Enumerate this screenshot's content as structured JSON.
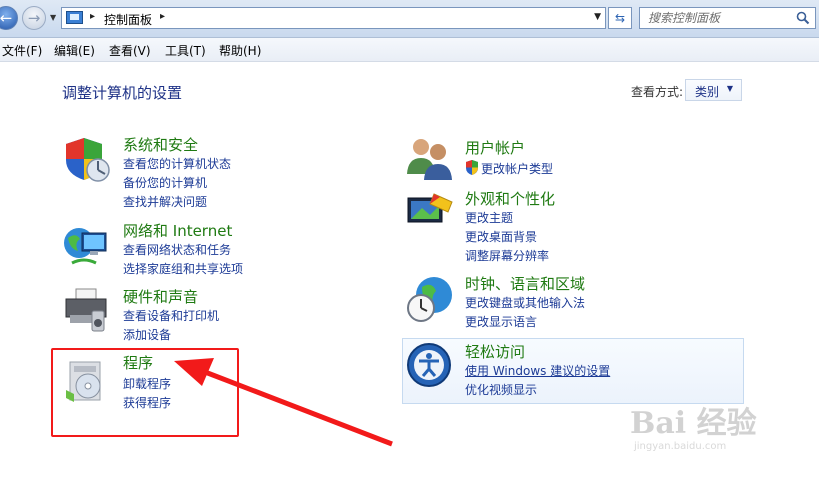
{
  "address_bar": {
    "back_glyph": "←",
    "forward_glyph": "→",
    "breadcrumb": "控制面板",
    "search_placeholder": "搜索控制面板",
    "refresh_glyph": "⇆"
  },
  "menu": [
    "文件(F)",
    "编辑(E)",
    "查看(V)",
    "工具(T)",
    "帮助(H)"
  ],
  "page_title": "调整计算机的设置",
  "view_by": {
    "label": "查看方式:",
    "value": "类别"
  },
  "categories_left": [
    {
      "title": "系统和安全",
      "links": [
        "查看您的计算机状态",
        "备份您的计算机",
        "查找并解决问题"
      ],
      "icon": "shield-icon"
    },
    {
      "title": "网络和 Internet",
      "links": [
        "查看网络状态和任务",
        "选择家庭组和共享选项"
      ],
      "icon": "network-globe-icon"
    },
    {
      "title": "硬件和声音",
      "links": [
        "查看设备和打印机",
        "添加设备"
      ],
      "icon": "printer-icon"
    },
    {
      "title": "程序",
      "links": [
        "卸载程序",
        "获得程序"
      ],
      "icon": "programs-disc-icon"
    }
  ],
  "categories_right": [
    {
      "title": "用户帐户",
      "links": [
        "更改帐户类型"
      ],
      "icon": "users-icon"
    },
    {
      "title": "外观和个性化",
      "links": [
        "更改主题",
        "更改桌面背景",
        "调整屏幕分辨率"
      ],
      "icon": "monitor-paint-icon"
    },
    {
      "title": "时钟、语言和区域",
      "links": [
        "更改键盘或其他输入法",
        "更改显示语言"
      ],
      "icon": "clock-globe-icon"
    },
    {
      "title": "轻松访问",
      "links": [
        "使用 Windows 建议的设置",
        "优化视频显示"
      ],
      "icon": "ease-of-access-icon"
    }
  ],
  "watermark": {
    "text": "Bai 经验",
    "sub": "jingyan.baidu.com"
  },
  "colors": {
    "accent": "#1d3b96",
    "category_title": "#1f7a12",
    "annotation": "#f21a1a"
  }
}
